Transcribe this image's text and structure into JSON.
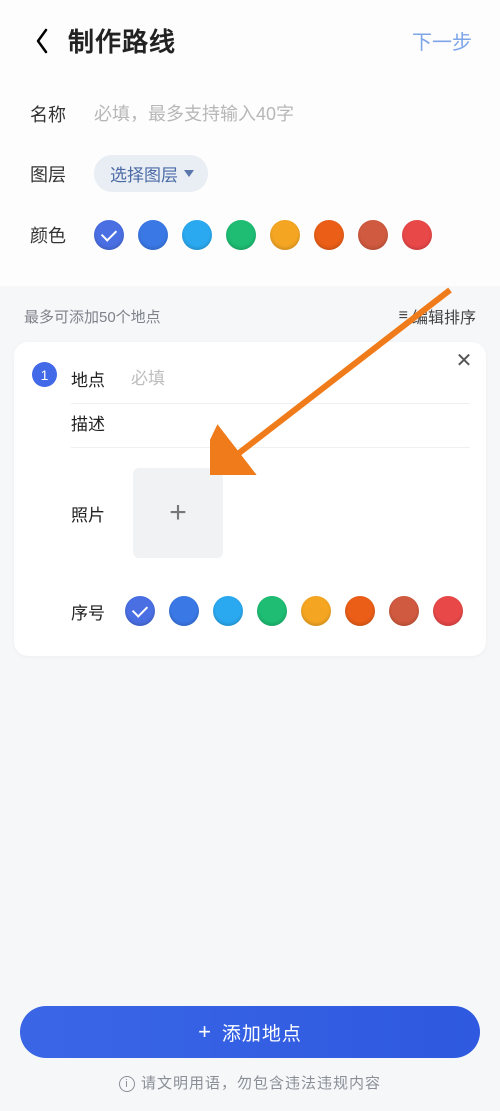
{
  "header": {
    "title": "制作路线",
    "next": "下一步"
  },
  "form": {
    "nameLabel": "名称",
    "namePlaceholder": "必填，最多支持输入40字",
    "layerLabel": "图层",
    "layerSelect": "选择图层",
    "colorLabel": "颜色"
  },
  "colors": [
    "#4a6fe3",
    "#3a78e6",
    "#2aa9f0",
    "#1ebd73",
    "#f4a623",
    "#ea5e17",
    "#d05a3f",
    "#e94848"
  ],
  "selectedColorIdx": 0,
  "pointsArea": {
    "maxNote": "最多可添加50个地点",
    "sortLabel": "编辑排序"
  },
  "point": {
    "index": "1",
    "locationLabel": "地点",
    "locationPlaceholder": "必填",
    "descLabel": "描述",
    "photoLabel": "照片",
    "seqLabel": "序号"
  },
  "seqColors": [
    "#4a6fe3",
    "#3a78e6",
    "#2aa9f0",
    "#1ebd73",
    "#f4a623",
    "#ea5e17",
    "#d05a3f",
    "#e94848"
  ],
  "seqSelectedIdx": 0,
  "bottom": {
    "addBtn": "添加地点",
    "warn": "请文明用语，勿包含违法违规内容"
  }
}
